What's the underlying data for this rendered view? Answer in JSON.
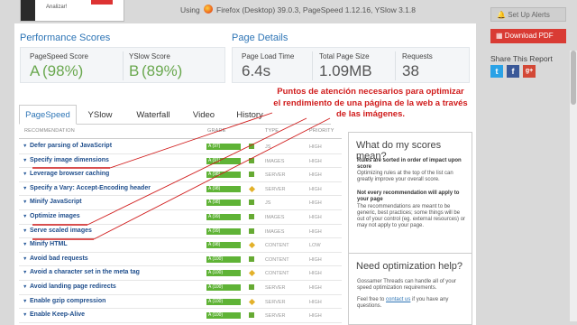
{
  "header": {
    "thumb_text": "Analizar!",
    "using_label": "Using",
    "using_value": "Firefox (Desktop) 39.0.3, PageSpeed 1.12.16, YSlow 3.1.8"
  },
  "performance": {
    "title": "Performance Scores",
    "pagespeed": {
      "label": "PageSpeed Score",
      "grade": "A",
      "value": "(98%)"
    },
    "yslow": {
      "label": "YSlow Score",
      "grade": "B",
      "value": "(89%)"
    }
  },
  "details": {
    "title": "Page Details",
    "load_time": {
      "label": "Page Load Time",
      "value": "6.4s"
    },
    "page_size": {
      "label": "Total Page Size",
      "value": "1.09MB"
    },
    "requests": {
      "label": "Requests",
      "value": "38"
    }
  },
  "tabs": [
    "PageSpeed",
    "YSlow",
    "Waterfall",
    "Video",
    "History"
  ],
  "table": {
    "headers": {
      "recommendation": "RECOMMENDATION",
      "grade": "GRADE",
      "type": "TYPE",
      "priority": "PRIORITY"
    },
    "rows": [
      {
        "name": "Defer parsing of JavaScript",
        "grade": "A (97)",
        "type": "JS",
        "priority": "HIGH",
        "icon": "green-square-icon"
      },
      {
        "name": "Specify image dimensions",
        "grade": "A (91)",
        "type": "IMAGES",
        "priority": "HIGH",
        "icon": "green-square-icon"
      },
      {
        "name": "Leverage browser caching",
        "grade": "A (98)",
        "type": "SERVER",
        "priority": "HIGH",
        "icon": "green-square-icon"
      },
      {
        "name": "Specify a Vary: Accept-Encoding header",
        "grade": "A (98)",
        "type": "SERVER",
        "priority": "HIGH",
        "icon": "diamond-icon"
      },
      {
        "name": "Minify JavaScript",
        "grade": "A (98)",
        "type": "JS",
        "priority": "HIGH",
        "icon": "green-square-icon"
      },
      {
        "name": "Optimize images",
        "grade": "A (99)",
        "type": "IMAGES",
        "priority": "HIGH",
        "icon": "green-square-icon"
      },
      {
        "name": "Serve scaled images",
        "grade": "A (99)",
        "type": "IMAGES",
        "priority": "HIGH",
        "icon": "green-square-icon"
      },
      {
        "name": "Minify HTML",
        "grade": "A (98)",
        "type": "CONTENT",
        "priority": "LOW",
        "icon": "diamond-icon"
      },
      {
        "name": "Avoid bad requests",
        "grade": "A (100)",
        "type": "CONTENT",
        "priority": "HIGH",
        "icon": "green-square-icon"
      },
      {
        "name": "Avoid a character set in the meta tag",
        "grade": "A (100)",
        "type": "CONTENT",
        "priority": "HIGH",
        "icon": "diamond-icon"
      },
      {
        "name": "Avoid landing page redirects",
        "grade": "A (100)",
        "type": "SERVER",
        "priority": "HIGH",
        "icon": "green-square-icon"
      },
      {
        "name": "Enable gzip compression",
        "grade": "A (100)",
        "type": "SERVER",
        "priority": "HIGH",
        "icon": "diamond-icon"
      },
      {
        "name": "Enable Keep-Alive",
        "grade": "A (100)",
        "type": "SERVER",
        "priority": "HIGH",
        "icon": "green-square-icon"
      }
    ]
  },
  "scores_box": {
    "title": "What do my scores mean?",
    "p1_bold": "Rules are sorted in order of impact upon score",
    "p1": "Optimizing rules at the top of the list can greatly improve your overall score.",
    "p2_bold": "Not every recommendation will apply to your page",
    "p2": "The recommendations are meant to be generic, best practices; some things will be out of your control (eg. external resources) or may not apply to your page."
  },
  "help_box": {
    "title": "Need optimization help?",
    "p1": "Gossamer Threads can handle all of your speed optimization requirements.",
    "p2_pre": "Feel free to",
    "p2_link": "contact us",
    "p2_post": "if you have any questions."
  },
  "annotation": "Puntos de atención necesarios para optimizar el rendimiento de una página de la web a través de las imágenes.",
  "right_panel": {
    "alerts_label": "Set Up Alerts",
    "pdf_label": "Download PDF",
    "share_label": "Share This Report",
    "share_icons": [
      "twitter-icon",
      "facebook-icon",
      "googleplus-icon"
    ]
  },
  "colors": {
    "accent": "#2e75b6",
    "grade_green": "#5fb336",
    "annotation_red": "#d01b1b",
    "pdf_red": "#d93b34"
  }
}
